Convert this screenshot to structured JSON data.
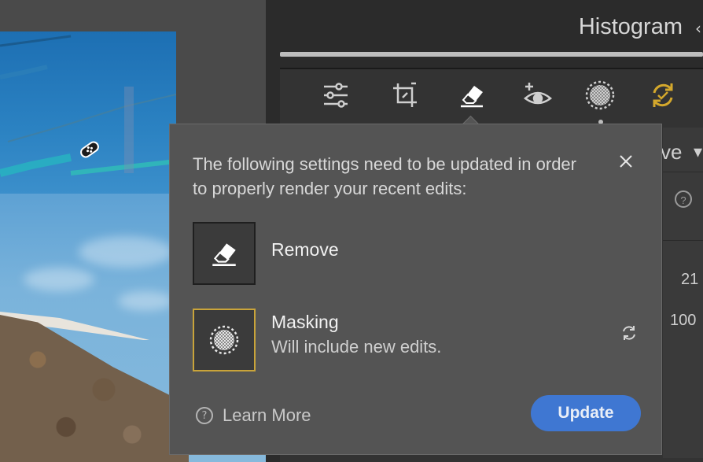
{
  "panel": {
    "histogram_title": "Histogram",
    "behind_header_text": "ve",
    "behind_value_1": "21",
    "behind_value_2": "100"
  },
  "toolbar": {
    "tools": [
      {
        "icon": "edit-sliders-icon"
      },
      {
        "icon": "crop-icon"
      },
      {
        "icon": "remove-eraser-icon",
        "active_dot": true
      },
      {
        "icon": "red-eye-icon"
      },
      {
        "icon": "masking-icon",
        "active_dot": true
      },
      {
        "icon": "presets-sync-icon",
        "color": "#d4a82c"
      }
    ]
  },
  "popup": {
    "message": "The following settings need to be updated in order to properly render your recent edits:",
    "settings": [
      {
        "name": "Remove",
        "subtitle": "",
        "icon": "eraser-icon",
        "active": false
      },
      {
        "name": "Masking",
        "subtitle": "Will include new edits.",
        "icon": "mask-dots-icon",
        "active": true
      }
    ],
    "learn_more": "Learn More",
    "update_label": "Update"
  },
  "colors": {
    "accent_button": "#3f77d2",
    "active_border": "#c9a43a",
    "popup_bg": "#545454"
  }
}
